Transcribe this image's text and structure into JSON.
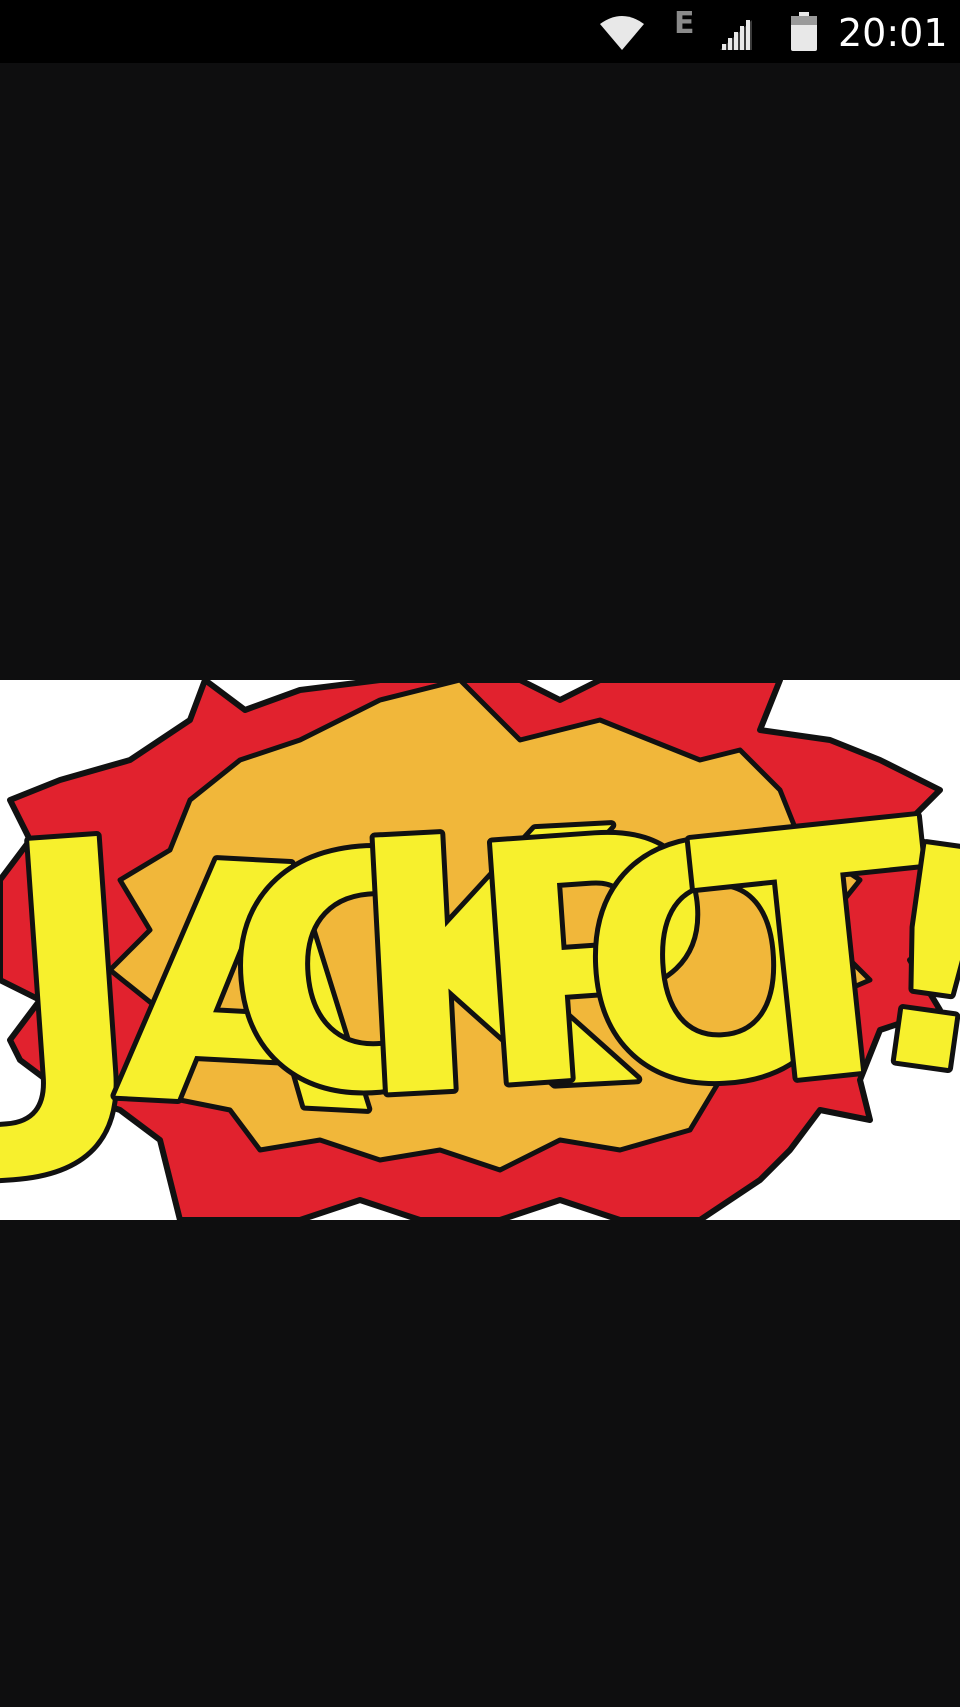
{
  "status_bar": {
    "network_type": "E",
    "time": "20:01",
    "icons": [
      "wifi-icon",
      "mobile-signal-icon",
      "battery-icon"
    ]
  },
  "image_viewer": {
    "background_color": "#0e0e0f",
    "image": {
      "text": "JACKPOT!",
      "letters": [
        "J",
        "A",
        "C",
        "K",
        "P",
        "O",
        "T",
        "!"
      ],
      "colors": {
        "letter_fill": "#f7f02d",
        "outline": "#111111",
        "burst_outer": "#e1222e",
        "burst_inner": "#f1b73a",
        "background": "#ffffff"
      }
    }
  }
}
